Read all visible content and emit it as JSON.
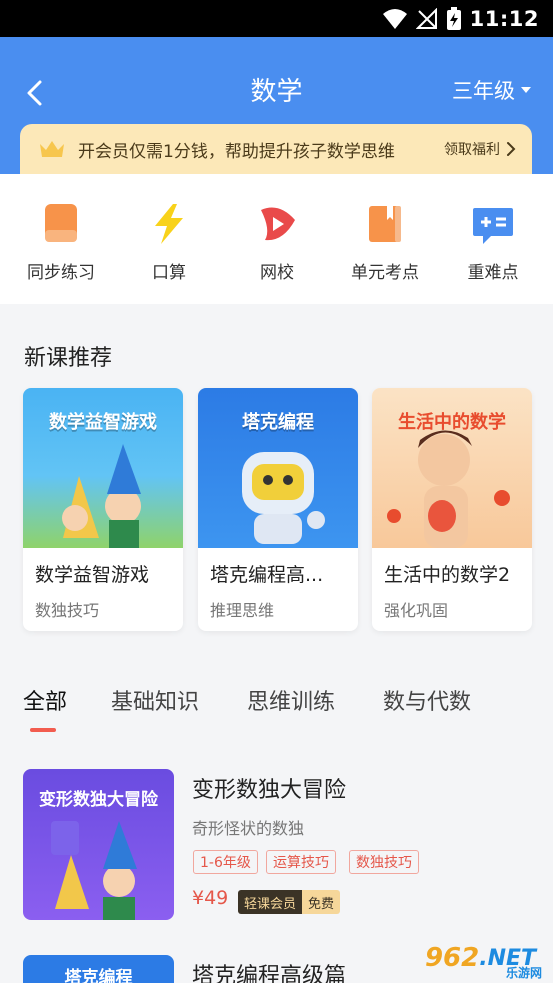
{
  "status_bar": {
    "time": "11:12"
  },
  "header": {
    "title": "数学",
    "grade": "三年级"
  },
  "vip_banner": {
    "text": "开会员仅需1分钱，帮助提升孩子数学思维",
    "action": "领取福利"
  },
  "quick_links": [
    {
      "label": "同步练习",
      "icon": "notebook-icon"
    },
    {
      "label": "口算",
      "icon": "lightning-icon"
    },
    {
      "label": "网校",
      "icon": "play-icon"
    },
    {
      "label": "单元考点",
      "icon": "book-icon"
    },
    {
      "label": "重难点",
      "icon": "plus-equals-icon"
    }
  ],
  "new_courses": {
    "title": "新课推荐",
    "items": [
      {
        "cover_text": "数学益智游戏",
        "name": "数学益智游戏",
        "tag": "数独技巧"
      },
      {
        "cover_text": "塔克编程",
        "name": "塔克编程高...",
        "tag": "推理思维"
      },
      {
        "cover_text": "生活中的数学",
        "name": "生活中的数学2",
        "tag": "强化巩固"
      }
    ]
  },
  "tabs": [
    "全部",
    "基础知识",
    "思维训练",
    "数与代数"
  ],
  "course_list": [
    {
      "cover_text": "变形数独大冒险",
      "title": "变形数独大冒险",
      "desc": "奇形怪状的数独",
      "tags": [
        "1-6年级",
        "运算技巧",
        "数独技巧"
      ],
      "price": "¥49",
      "vip_label": "轻课会员",
      "vip_value": "免费"
    },
    {
      "cover_text": "塔克编程",
      "title": "塔克编程高级篇"
    }
  ],
  "watermark": {
    "number": "962",
    "suffix": ".NET",
    "cn": "乐游网"
  },
  "colors": {
    "header": "#4a8ef0",
    "accent": "#e5574a",
    "vip_bg": "#fce8b8"
  }
}
